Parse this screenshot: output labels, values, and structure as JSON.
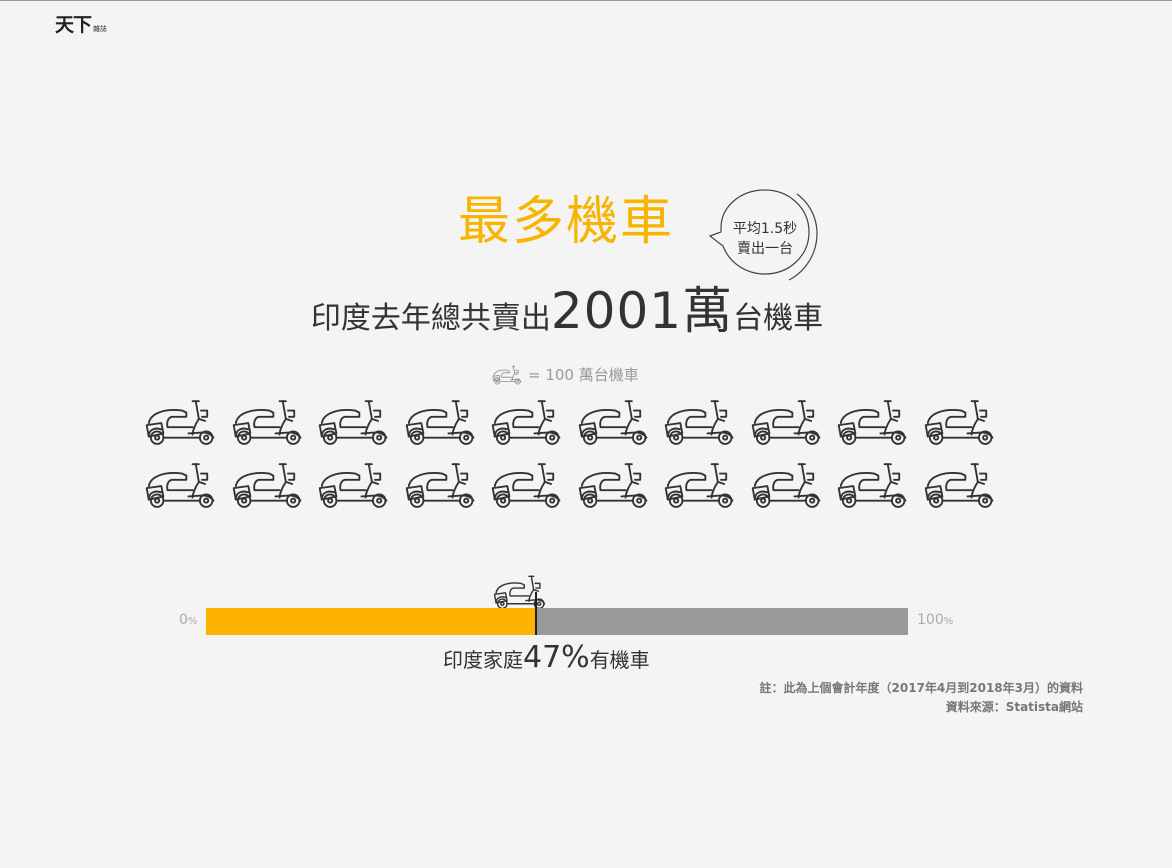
{
  "logo": {
    "main": "天下",
    "sub": "雜誌"
  },
  "title": "最多機車",
  "bubble": {
    "line1": "平均1.5秒",
    "line2": "賣出一台"
  },
  "headline": {
    "prefix": "印度去年總共賣出",
    "number": "2001萬",
    "suffix": "台機車"
  },
  "legend": {
    "text": "= 100 萬台機車",
    "icon": "scooter-icon"
  },
  "pictogram": {
    "total_units": 20,
    "unit_value_wan": 100,
    "per_row": 10,
    "icon": "scooter-icon"
  },
  "progress": {
    "label_min": "0",
    "label_max": "100",
    "unit": "%",
    "value": 47,
    "caption_prefix": "印度家庭",
    "caption_value": "47%",
    "caption_suffix": "有機車"
  },
  "note": {
    "line1": "註：此為上個會計年度（2017年4月到2018年3月）的資料",
    "line2": "資料來源：Statista網站"
  },
  "colors": {
    "accent": "#f7b500",
    "bar_fill": "#fdb300",
    "bar_track": "#999999",
    "text": "#333333"
  }
}
